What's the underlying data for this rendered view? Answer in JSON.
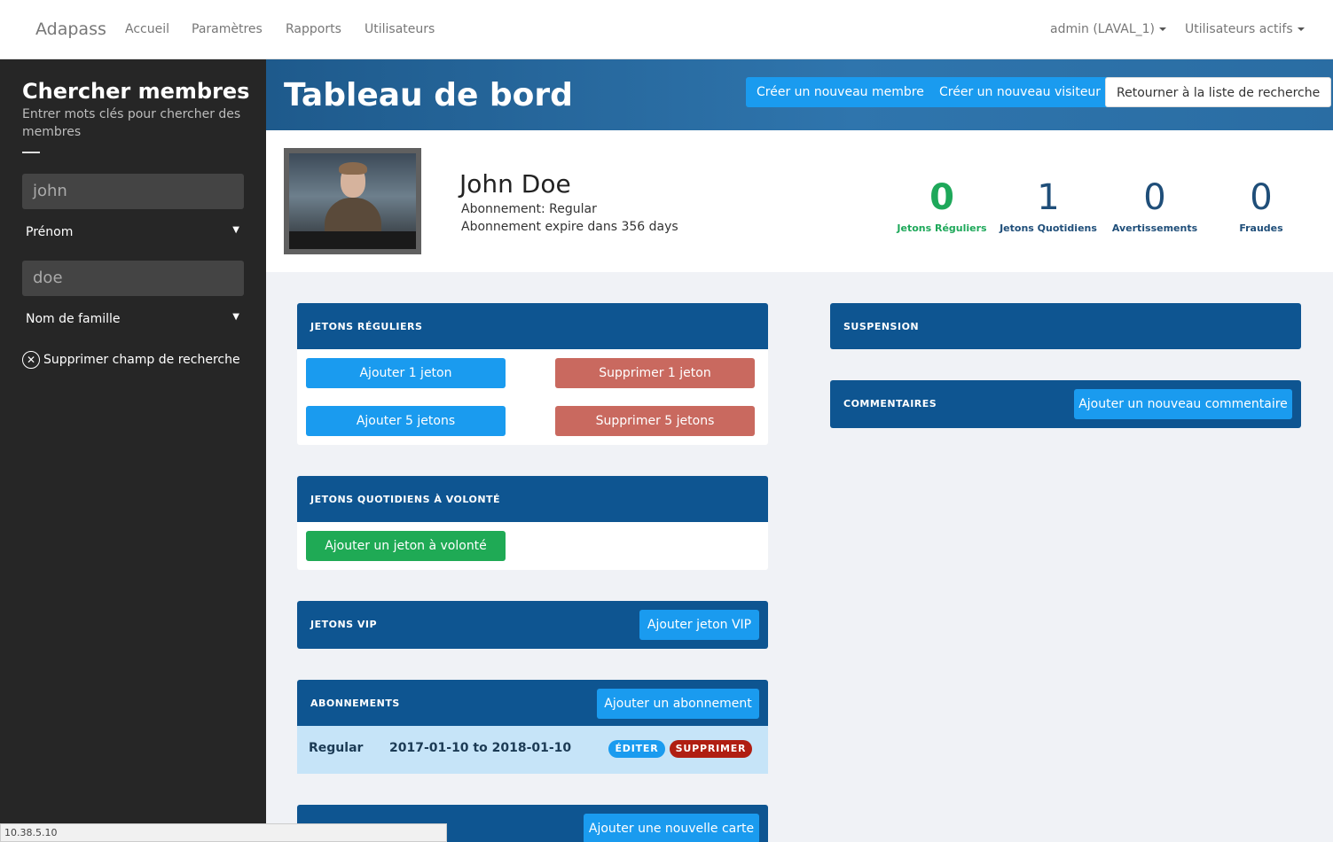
{
  "nav": {
    "brand": "Adapass",
    "links": [
      "Accueil",
      "Paramètres",
      "Rapports",
      "Utilisateurs"
    ],
    "user_menu": "admin (LAVAL_1)",
    "active_users_menu": "Utilisateurs actifs"
  },
  "sidebar": {
    "title": "Chercher membres",
    "subtitle": "Entrer mots clés pour chercher des membres",
    "fields": [
      {
        "value": "john",
        "select": "Prénom"
      },
      {
        "value": "doe",
        "select": "Nom de famille"
      }
    ],
    "clear_label": "Supprimer champ de recherche"
  },
  "header": {
    "title": "Tableau de bord",
    "buttons": [
      "Créer un nouveau membre",
      "Créer un nouveau visiteur",
      "Retourner à la liste de recherche"
    ]
  },
  "profile": {
    "name": "John Doe",
    "subscription": "Abonnement: Regular",
    "expiry": "Abonnement expire dans 356 days",
    "stats": [
      {
        "value": "0",
        "label": "Jetons Réguliers"
      },
      {
        "value": "1",
        "label": "Jetons Quotidiens"
      },
      {
        "value": "0",
        "label": "Avertissements"
      },
      {
        "value": "0",
        "label": "Fraudes"
      }
    ]
  },
  "panels": {
    "regular_tokens": {
      "title": "JETONS RÉGULIERS",
      "add1": "Ajouter 1 jeton",
      "remove1": "Supprimer 1 jeton",
      "add5": "Ajouter 5 jetons",
      "remove5": "Supprimer 5 jetons"
    },
    "daily_tokens": {
      "title": "JETONS QUOTIDIENS À VOLONTÉ",
      "add": "Ajouter un jeton à volonté"
    },
    "vip_tokens": {
      "title": "JETONS VIP",
      "add": "Ajouter jeton VIP"
    },
    "subscriptions": {
      "title": "ABONNEMENTS",
      "add": "Ajouter un abonnement",
      "rows": [
        {
          "name": "Regular",
          "dates": "2017-01-10 to 2018-01-10",
          "edit": "ÉDITER",
          "delete": "SUPPRIMER"
        }
      ]
    },
    "cards": {
      "add": "Ajouter une nouvelle carte"
    },
    "suspension": {
      "title": "SUSPENSION"
    },
    "comments": {
      "title": "COMMENTAIRES",
      "add": "Ajouter un nouveau commentaire"
    }
  },
  "statusbar": "10.38.5.10",
  "colors": {
    "panel_header": "#0e5591",
    "primary_button": "#1a9bef",
    "danger_button": "#c9695f",
    "success": "#1faa55",
    "sidebar": "#262626"
  }
}
